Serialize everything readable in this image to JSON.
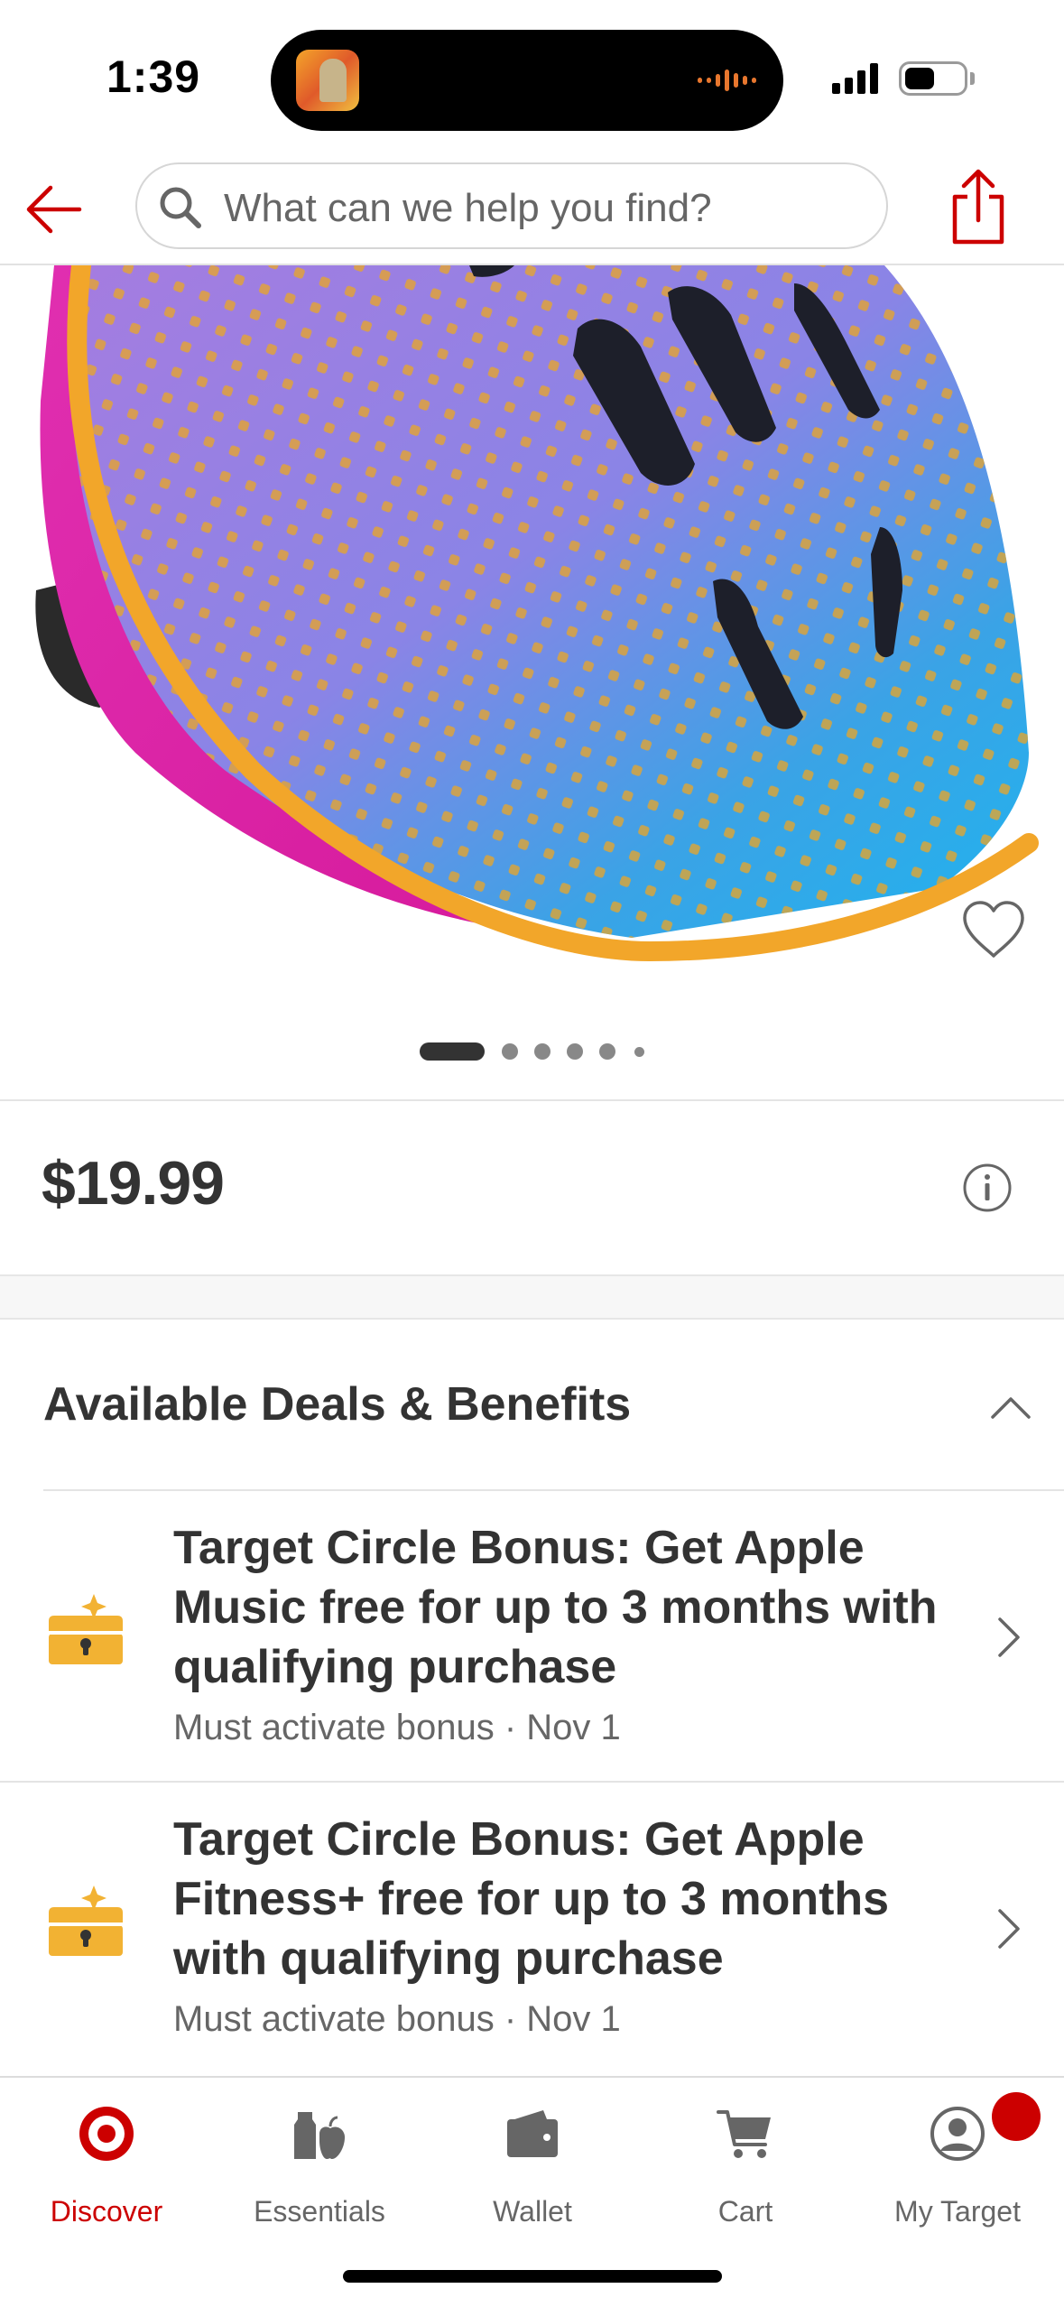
{
  "status_bar": {
    "time": "1:39"
  },
  "header": {
    "search_placeholder": "What can we help you find?",
    "icons": [
      "back-arrow-icon",
      "search-icon",
      "share-icon"
    ]
  },
  "product": {
    "image_description_icon": "bike-helmet-image",
    "carousel": {
      "total": 6,
      "active_index": 0
    },
    "price": "$19.99"
  },
  "deals": {
    "title": "Available Deals & Benefits",
    "items": [
      {
        "icon": "treasure-chest-icon",
        "title": "Target Circle Bonus: Get Apple Music free for up to 3 months with qualifying purchase",
        "subtitle": "Must activate bonus · Nov 1"
      },
      {
        "icon": "treasure-chest-icon",
        "title": "Target Circle Bonus: Get Apple Fitness+ free for up to 3 months with qualifying purchase",
        "subtitle": "Must activate bonus · Nov 1"
      }
    ]
  },
  "bottom_nav": {
    "items": [
      {
        "label": "Discover",
        "icon": "target-bullseye-icon",
        "active": true
      },
      {
        "label": "Essentials",
        "icon": "essentials-icon",
        "active": false
      },
      {
        "label": "Wallet",
        "icon": "wallet-icon",
        "active": false
      },
      {
        "label": "Cart",
        "icon": "cart-icon",
        "active": false
      },
      {
        "label": "My Target",
        "icon": "account-icon",
        "active": false,
        "badge": true
      }
    ]
  },
  "colors": {
    "brand_red": "#cc0000",
    "text_dark": "#333333",
    "text_muted": "#666666",
    "chest_gold": "#f2b233"
  }
}
